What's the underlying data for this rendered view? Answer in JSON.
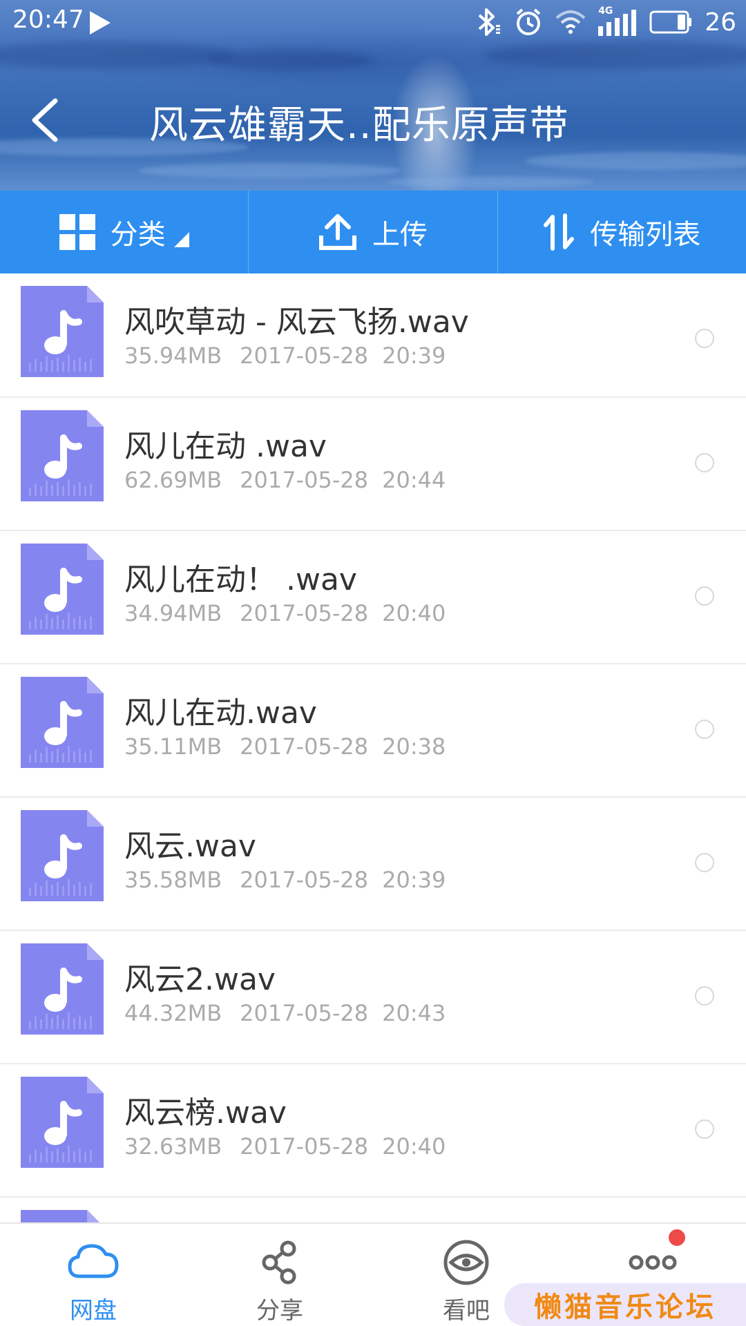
{
  "statusbar": {
    "time": "20:47",
    "network": "4G",
    "battery": "26"
  },
  "header": {
    "title": "风云雄霸天..配乐原声带"
  },
  "toolbar": {
    "category_label": "分类",
    "upload_label": "上传",
    "transfer_label": "传输列表"
  },
  "files": [
    {
      "name": "风吹草动 - 风云飞扬.wav",
      "size": "35.94MB",
      "date": "2017-05-28",
      "time": "20:39"
    },
    {
      "name": "风儿在动 .wav",
      "size": "62.69MB",
      "date": "2017-05-28",
      "time": "20:44"
    },
    {
      "name": "风儿在动！ .wav",
      "size": "34.94MB",
      "date": "2017-05-28",
      "time": "20:40"
    },
    {
      "name": "风儿在动.wav",
      "size": "35.11MB",
      "date": "2017-05-28",
      "time": "20:38"
    },
    {
      "name": "风云.wav",
      "size": "35.58MB",
      "date": "2017-05-28",
      "time": "20:39"
    },
    {
      "name": "风云2.wav",
      "size": "44.32MB",
      "date": "2017-05-28",
      "time": "20:43"
    },
    {
      "name": "风云榜.wav",
      "size": "32.63MB",
      "date": "2017-05-28",
      "time": "20:40"
    }
  ],
  "nav": {
    "items": [
      {
        "label": "网盘",
        "icon": "cloud-icon",
        "active": true
      },
      {
        "label": "分享",
        "icon": "share-icon",
        "active": false
      },
      {
        "label": "看吧",
        "icon": "eye-icon",
        "active": false
      },
      {
        "label": "",
        "icon": "more-icon",
        "active": false
      }
    ]
  },
  "watermark": "懒猫音乐论坛",
  "colors": {
    "accent": "#2e8ff0",
    "file_icon": "#8585f0",
    "badge": "#ef4a4a",
    "watermark_text": "#f08a14"
  }
}
